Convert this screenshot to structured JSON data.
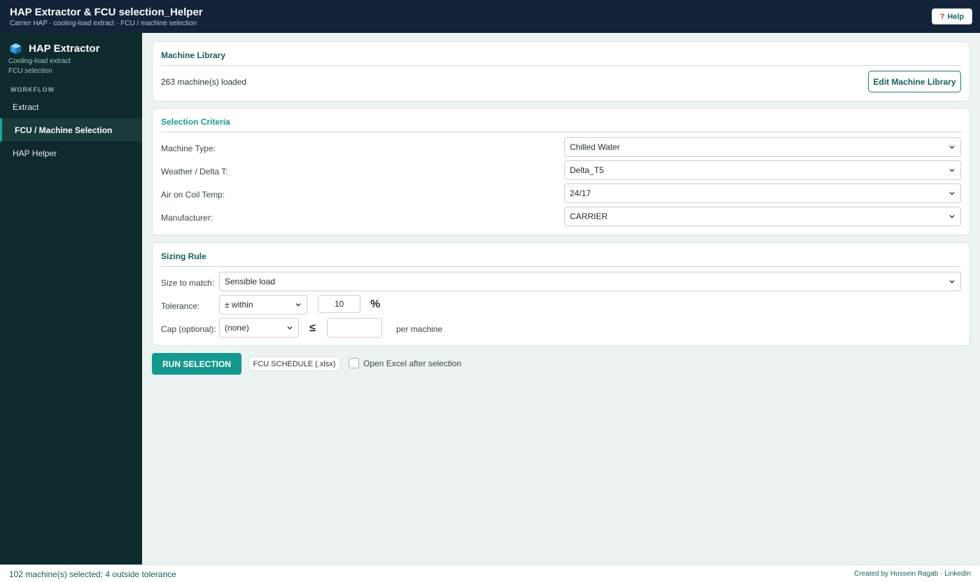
{
  "header": {
    "title": "HAP Extractor & FCU selection_Helper",
    "subtitle": "Carrier HAP · cooling-load extract · FCU / machine selection",
    "help_label": "Help",
    "help_icon_glyph": "?"
  },
  "sidebar": {
    "brand_title": "HAP Extractor",
    "brand_sub_1": "Cooling-load extract",
    "brand_sub_2": "FCU selection",
    "section_label": "WORKFLOW",
    "items": [
      {
        "label": "Extract",
        "active": false
      },
      {
        "label": "FCU / Machine Selection",
        "active": true
      },
      {
        "label": "HAP Helper",
        "active": false
      }
    ]
  },
  "machine_library": {
    "title": "Machine Library",
    "loaded_text": "263 machine(s) loaded",
    "edit_button": "Edit Machine Library"
  },
  "selection_criteria": {
    "title": "Selection Criteria",
    "rows": [
      {
        "label": "Machine Type:",
        "value": "Chilled Water"
      },
      {
        "label": "Weather / Delta T:",
        "value": "Delta_T5"
      },
      {
        "label": "Air on Coil Temp:",
        "value": "24/17"
      },
      {
        "label": "Manufacturer:",
        "value": "CARRIER"
      }
    ]
  },
  "sizing_rule": {
    "title": "Sizing Rule",
    "size_to_match_label": "Size to match:",
    "size_to_match_value": "Sensible load",
    "tolerance_label": "Tolerance:",
    "tolerance_mode": "± within",
    "tolerance_value": "10",
    "tolerance_unit": "%",
    "cap_label": "Cap (optional):",
    "cap_mode": "(none)",
    "cap_symbol": "≤",
    "cap_value": "",
    "cap_suffix": "per machine"
  },
  "actions": {
    "run_label": "RUN SELECTION",
    "schedule_label": "FCU SCHEDULE (.xlsx)",
    "open_excel_label": "Open Excel after selection",
    "open_excel_checked": false
  },
  "status": {
    "left": "102 machine(s) selected; 4 outside tolerance",
    "right": "Created by Hussein Ragab · LinkedIn"
  },
  "colors": {
    "topbar": "#13233a",
    "sidebar": "#0f2a2c",
    "accent": "#14998e",
    "heading": "#17605c"
  }
}
